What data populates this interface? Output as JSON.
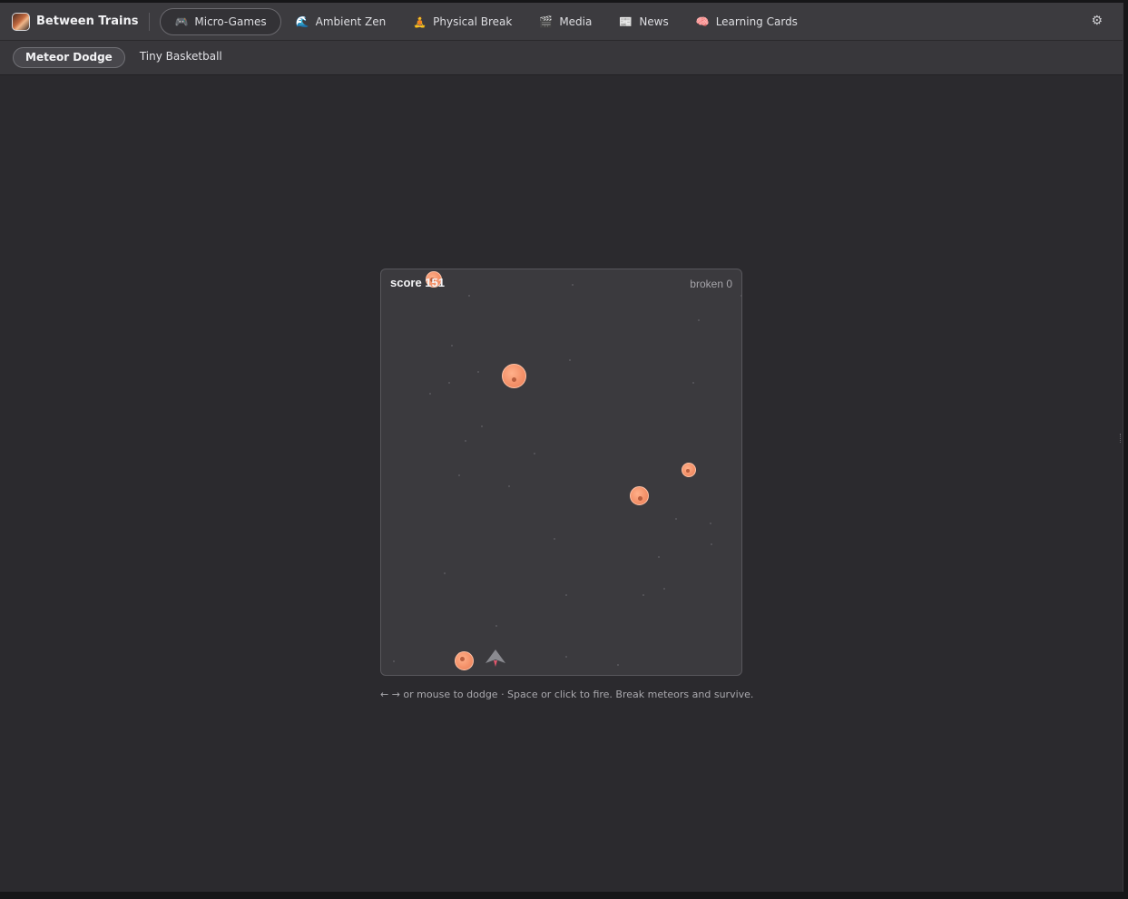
{
  "app": {
    "title": "Between Trains"
  },
  "nav": {
    "tabs": [
      {
        "label": "Micro-Games",
        "icon": "🎮",
        "icon_name": "gamepad-icon",
        "active": true
      },
      {
        "label": "Ambient Zen",
        "icon": "🌊",
        "icon_name": "wave-icon",
        "active": false
      },
      {
        "label": "Physical Break",
        "icon": "🧘",
        "icon_name": "meditation-icon",
        "active": false
      },
      {
        "label": "Media",
        "icon": "🎬",
        "icon_name": "clapper-icon",
        "active": false
      },
      {
        "label": "News",
        "icon": "📰",
        "icon_name": "newspaper-icon",
        "active": false
      },
      {
        "label": "Learning Cards",
        "icon": "🧠",
        "icon_name": "brain-icon",
        "active": false
      }
    ],
    "settings_icon": "⚙"
  },
  "subnav": {
    "tabs": [
      {
        "label": "Meteor Dodge",
        "active": true
      },
      {
        "label": "Tiny Basketball",
        "active": false
      }
    ]
  },
  "game": {
    "score_label": "score 151",
    "broken_label": "broken 0",
    "hint": "← → or mouse to dodge · Space or click to fire. Break meteors and survive.",
    "colors": {
      "meteor": "#f4926a",
      "ship": "#8a8a90",
      "flame": "#e0566c",
      "panel": "#3b3a3e"
    }
  }
}
